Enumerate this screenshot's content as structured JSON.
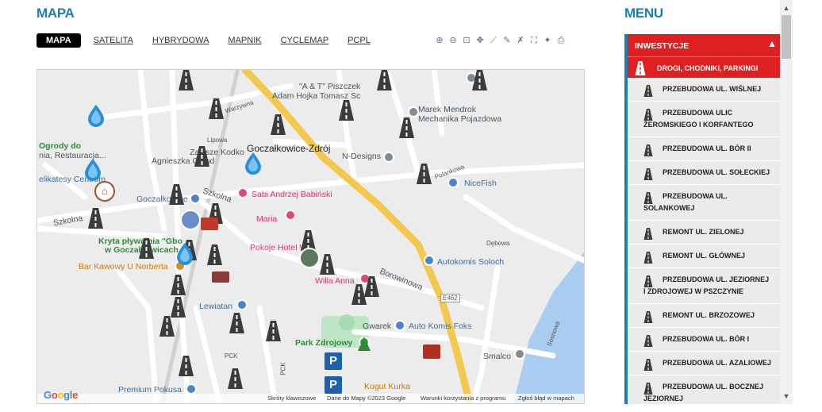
{
  "page": {
    "map_title": "MAPA",
    "menu_title": "MENU"
  },
  "tabs": [
    {
      "label": "MAPA",
      "active": true
    },
    {
      "label": "SATELITA"
    },
    {
      "label": "HYBRYDOWA"
    },
    {
      "label": "MAPNIK"
    },
    {
      "label": "CYCLEMAP"
    },
    {
      "label": "PCPL"
    }
  ],
  "tools": [
    "zoom-in-icon",
    "zoom-out-icon",
    "zoom-box-icon",
    "pan-icon",
    "measure-icon",
    "draw-icon",
    "erase-icon",
    "fullscreen-icon",
    "locate-icon",
    "print-icon"
  ],
  "map": {
    "labels": {
      "town": "Goczałkowice-Zdrój",
      "piszczek": "\"A & T\" Piszczek",
      "hojka": "Adam Hojka Tomasz Sc",
      "mendrok1": "Marek Mendrok",
      "mendrok2": "Mechanika Pojazdowa",
      "zawsze1": "Zawsze Kodko",
      "zawsze2": "Agnieszka Gland",
      "ndesigns": "N-Designs",
      "ogrody1": "Ogrody do",
      "ogrody2": "nia, Restauracja...",
      "delikatesy": "elikatesy Centrum",
      "babinski": "Sabi Andrzej Babiński",
      "nicefish": "NiceFish",
      "goczalkowice": "Goczałkowice",
      "maria": "Maria",
      "kryta": "Kryta pływalnia \"Gbo",
      "kryta2": "w Goczałkowicach",
      "bar": "Bar Kawowy U Norberta",
      "pokoje": "Pokoje Hotel Wik",
      "autokomis": "Autokomis Soloch",
      "willa": "Willa Anna",
      "lewiatan": "Lewiatan",
      "gwarek": "Gwarek",
      "autokomisfoks": "Auto Komis Foks",
      "park": "Park Zdrojowy",
      "smalco": "Smalco",
      "premium": "Premium Pokusa",
      "kogut": "Kogut Kurka",
      "szkolna": "Szkolna",
      "szkolna2": "Szkolna",
      "borowinowa": "Borowinowa",
      "e462": "E462",
      "lipowa": "Lipowa",
      "warzywna": "Warzywna",
      "debowa": "Dębowa",
      "sosnowa": "Sosnowa",
      "plankowa": "Polankowa",
      "pck": "PCK",
      "pck2": "PCK"
    },
    "footer": {
      "shortcuts": "Skróty klawiszowe",
      "data": "Dane do Mapy ©2023 Google",
      "terms": "Warunki korzystania z programu",
      "report": "Zgłoś błąd w mapach"
    },
    "google": [
      "G",
      "o",
      "o",
      "g",
      "l",
      "e"
    ]
  },
  "menu": {
    "section": "INWESTYCJE",
    "category": "DROGI, CHODNIKI, PARKINGI",
    "items": [
      "PRZEBUDOWA UL. WIŚLNEJ",
      "PRZEBUDOWA ULIC ŻEROMSKIEGO I KORFANTEGO",
      "PRZEBUDOWA UL. BÓR II",
      "PRZEBUDOWA UL. SOŁECKIEJ",
      "PRZEBUDOWA UL. SOLANKOWEJ",
      "REMONT UL. ZIELONEJ",
      "REMONT UL. GŁÓWNEJ",
      "PRZEBUDOWA UL. JEZIORNEJ I ZDROJOWEJ W PSZCZYNIE",
      "REMONT UL. BRZOZOWEJ",
      "PRZEBUDOWA UL. BÓR I",
      "PRZEBUDOWA UL. AZALIOWEJ",
      "PRZEBUDOWA UL. BOCZNEJ JEZIORNEJ"
    ]
  },
  "colors": {
    "accent": "#1a7fb5",
    "menu_red": "#e02020"
  }
}
